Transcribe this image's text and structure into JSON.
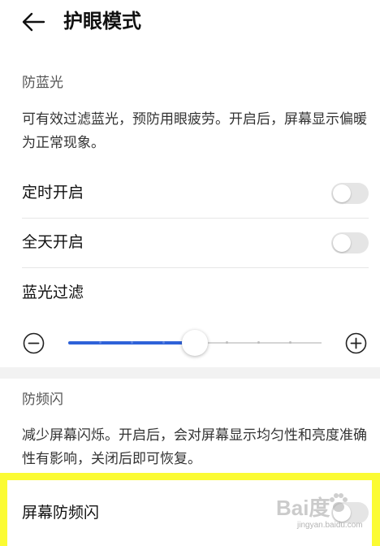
{
  "header": {
    "title": "护眼模式",
    "back_icon": "arrow-left-icon"
  },
  "blue_light": {
    "section_label": "防蓝光",
    "description": "可有效过滤蓝光，预防用眼疲劳。开启后，屏幕显示偏暖为正常现象。",
    "scheduled": {
      "label": "定时开启",
      "on": false
    },
    "all_day": {
      "label": "全天开启",
      "on": false
    },
    "filter_label": "蓝光过滤",
    "filter_level": 0.5,
    "minus_icon": "minus-circle-icon",
    "plus_icon": "plus-circle-icon"
  },
  "anti_flicker": {
    "section_label": "防频闪",
    "description": "减少屏幕闪烁。开启后，会对屏幕显示均匀性和亮度准确性有影响，关闭后即可恢复。",
    "screen_anti_flicker": {
      "label": "屏幕防频闪",
      "on": false
    }
  },
  "watermark": {
    "text": "Bai度",
    "url": "jingyan.baidu.com"
  },
  "colors": {
    "accent": "#2f62d8",
    "highlight": "#fbfb33",
    "toggle_off": "#e5e5e5"
  }
}
